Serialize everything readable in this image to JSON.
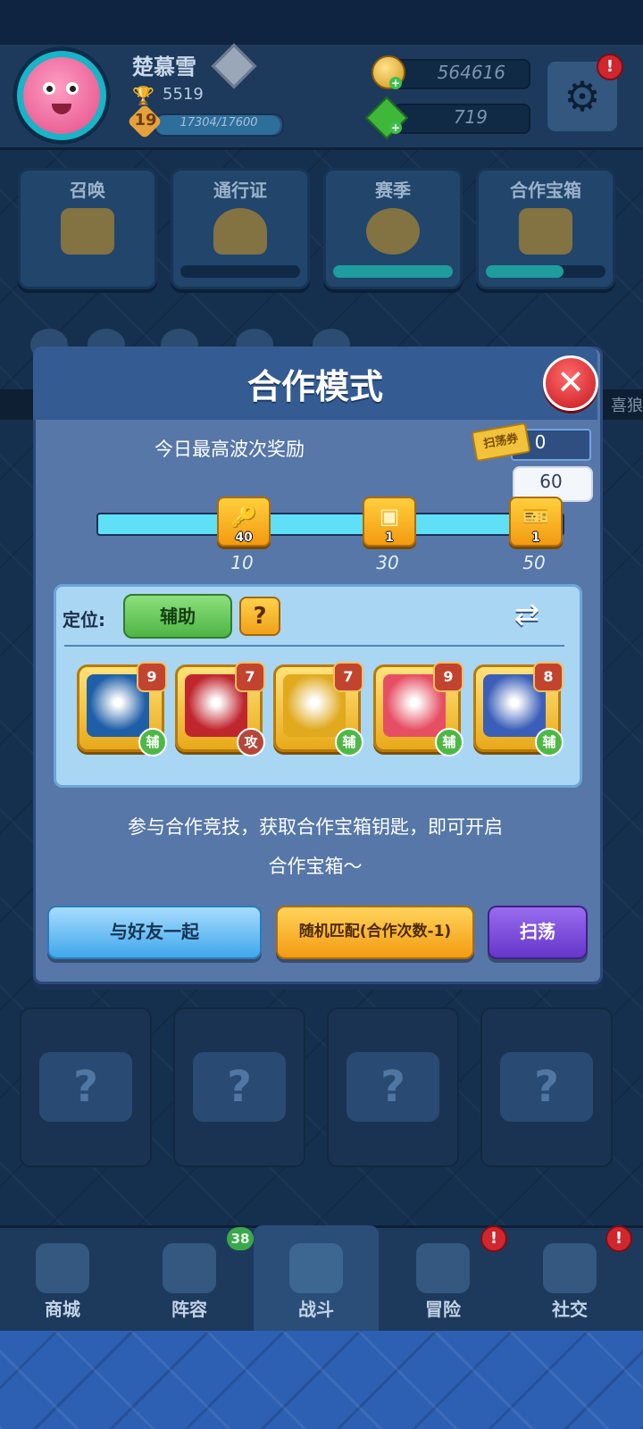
{
  "player": {
    "name": "楚慕雪",
    "trophies": "5519",
    "level": "19",
    "xp": "17304/17600",
    "xp_fraction": 0.983
  },
  "resources": {
    "gold": "564616",
    "gems": "719"
  },
  "header": {
    "settings_alert": "!"
  },
  "feature_cards": [
    {
      "label": "召唤",
      "progress": null
    },
    {
      "label": "通行证",
      "progress": 0.0
    },
    {
      "label": "赛季",
      "progress": 1.0
    },
    {
      "label": "合作宝箱",
      "progress": 0.65
    }
  ],
  "ticker": {
    "text": "喜狼"
  },
  "modal": {
    "title": "合作模式",
    "close_glyph": "✕",
    "reward_title": "今日最高波次奖励",
    "sweep_ticket_label": "扫荡券",
    "sweep_ticket_count": "0",
    "current_best_wave": "60",
    "milestones": [
      {
        "wave": "10",
        "reward": "key",
        "qty": "40"
      },
      {
        "wave": "30",
        "reward": "card",
        "qty": "1"
      },
      {
        "wave": "50",
        "reward": "sweep-ticket",
        "qty": "1"
      }
    ],
    "role_label": "定位:",
    "role_value": "辅助",
    "help_glyph": "?",
    "swap_glyph": "⇄",
    "dice": [
      {
        "name": "lightning-dice",
        "level": "9",
        "type": "辅",
        "color": "#1f5fa8"
      },
      {
        "name": "blade-dice",
        "level": "7",
        "type": "攻",
        "color": "#c0262e"
      },
      {
        "name": "coin-dice",
        "level": "7",
        "type": "辅",
        "color": "#e0a91e"
      },
      {
        "name": "hat-dice",
        "level": "9",
        "type": "辅",
        "color": "#e64f63"
      },
      {
        "name": "figure-dice",
        "level": "8",
        "type": "辅",
        "color": "#3b5fb8"
      }
    ],
    "description_line1": "参与合作竞技，获取合作宝箱钥匙，即可开启",
    "description_line2": "合作宝箱～",
    "btn_friend": "与好友一起",
    "btn_random": "随机匹配(合作次数-1)",
    "btn_sweep": "扫荡"
  },
  "mystery_cards": [
    "?",
    "?",
    "?",
    "?"
  ],
  "nav": {
    "items": [
      {
        "label": "商城",
        "icon": "shop-icon"
      },
      {
        "label": "阵容",
        "icon": "dice-icon",
        "badge": "38"
      },
      {
        "label": "战斗",
        "icon": "crossed-swords-icon"
      },
      {
        "label": "冒险",
        "icon": "adventure-icon",
        "alert": "!"
      },
      {
        "label": "社交",
        "icon": "chat-icon",
        "alert": "!"
      }
    ]
  }
}
